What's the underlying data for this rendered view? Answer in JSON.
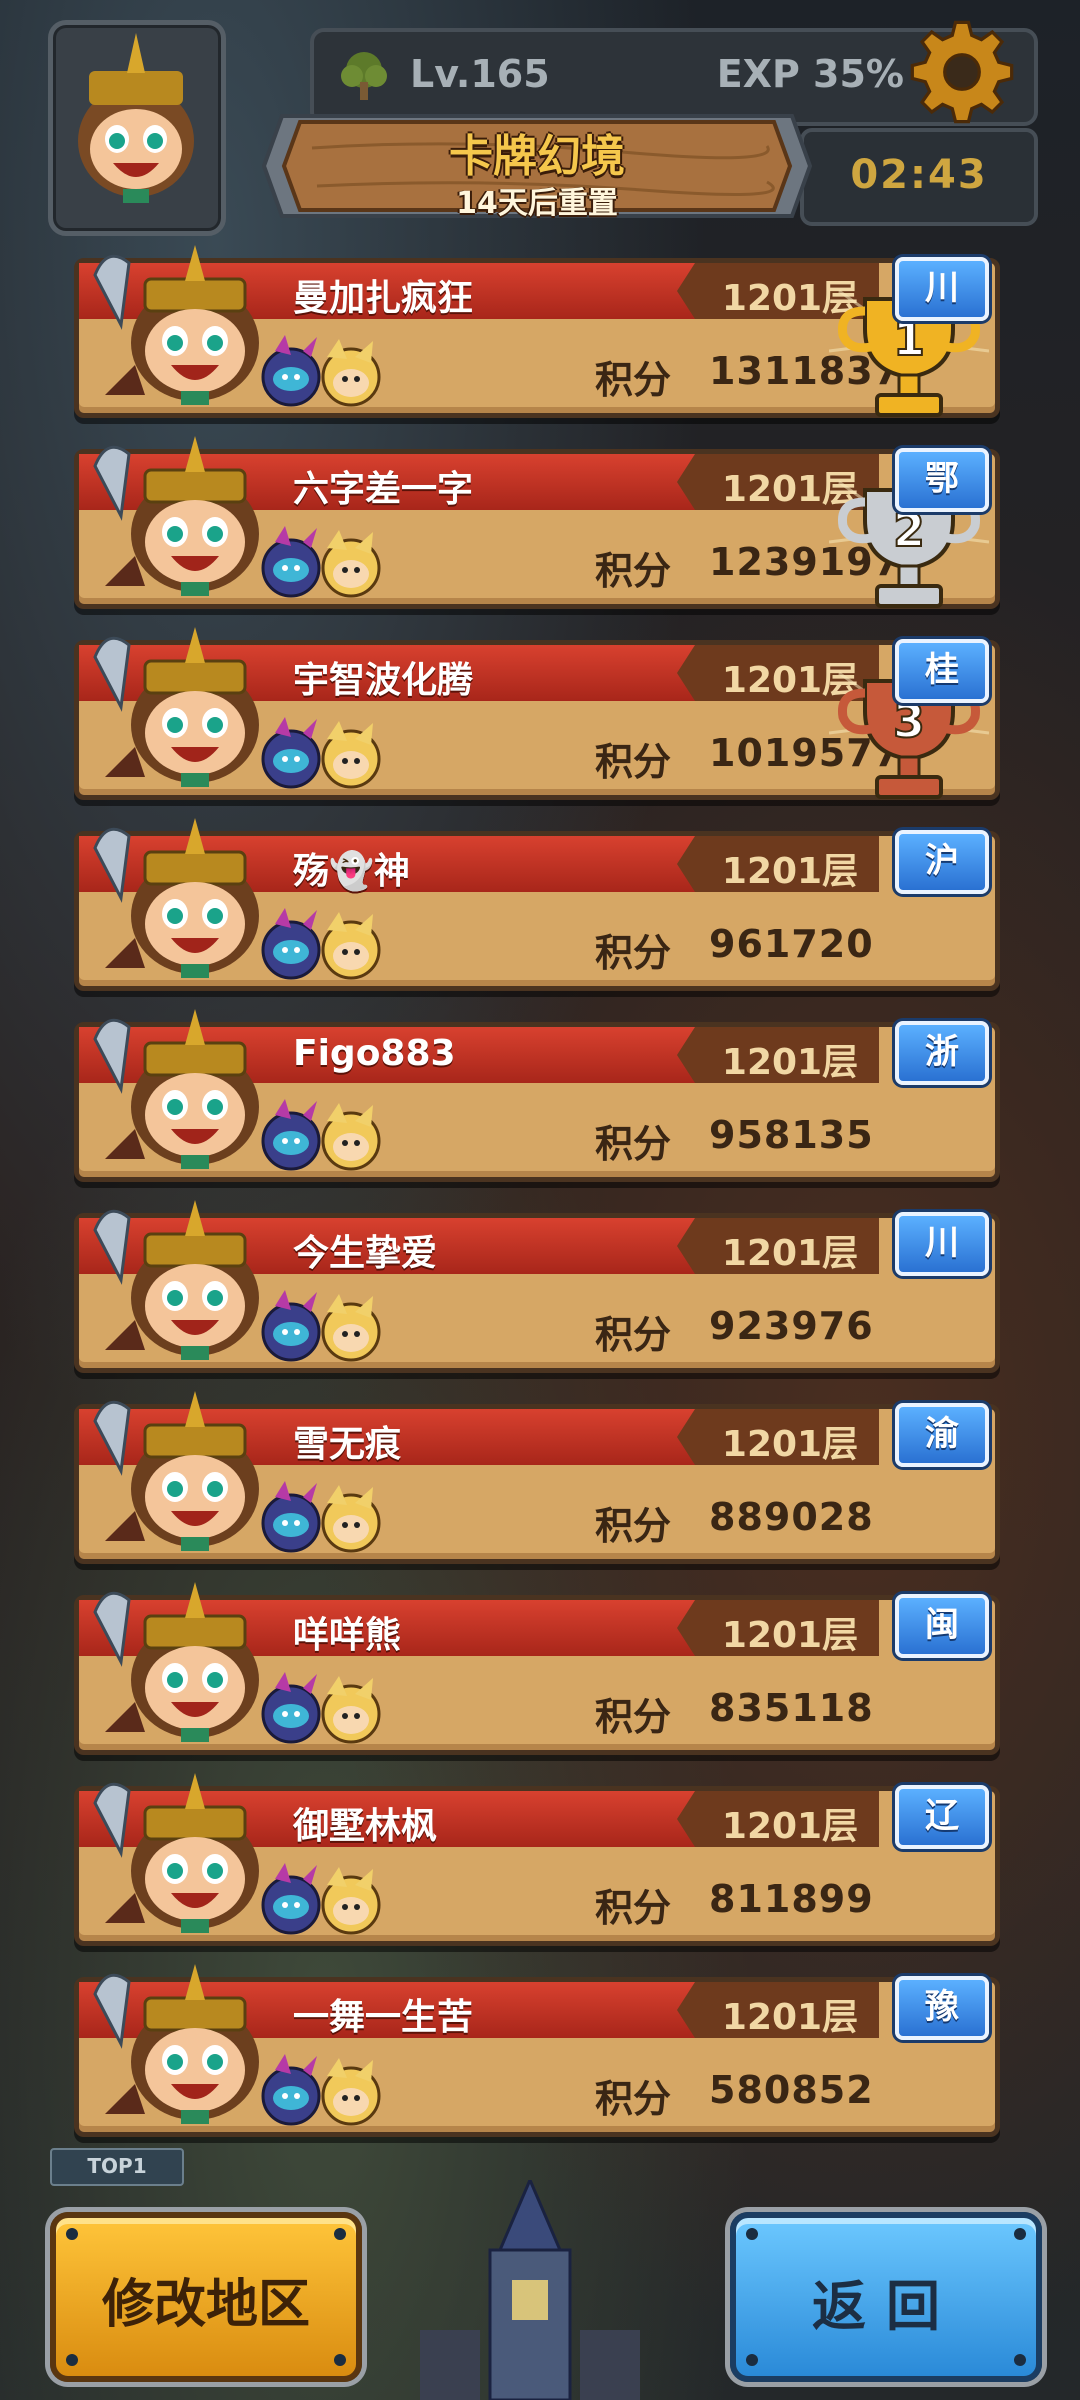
{
  "header": {
    "level": "Lv.165",
    "exp": "EXP 35%",
    "title": "卡牌幻境",
    "subtitle": "14天后重置",
    "timer": "02:43"
  },
  "ranking": [
    {
      "name": "曼加扎疯狂",
      "floor": "1201层",
      "score_label": "积分",
      "score": "1311837",
      "region": "川",
      "trophy": "gold"
    },
    {
      "name": "六字差一字",
      "floor": "1201层",
      "score_label": "积分",
      "score": "1239197",
      "region": "鄂",
      "trophy": "silver"
    },
    {
      "name": "宇智波化腾",
      "floor": "1201层",
      "score_label": "积分",
      "score": "1019577",
      "region": "桂",
      "trophy": "bronze"
    },
    {
      "name": "殇👻神",
      "floor": "1201层",
      "score_label": "积分",
      "score": "961720",
      "region": "沪",
      "trophy": ""
    },
    {
      "name": "Figo883",
      "floor": "1201层",
      "score_label": "积分",
      "score": "958135",
      "region": "浙",
      "trophy": ""
    },
    {
      "name": "今生挚爱",
      "floor": "1201层",
      "score_label": "积分",
      "score": "923976",
      "region": "川",
      "trophy": ""
    },
    {
      "name": "雪无痕",
      "floor": "1201层",
      "score_label": "积分",
      "score": "889028",
      "region": "渝",
      "trophy": ""
    },
    {
      "name": "咩咩熊",
      "floor": "1201层",
      "score_label": "积分",
      "score": "835118",
      "region": "闽",
      "trophy": ""
    },
    {
      "name": "御墅林枫",
      "floor": "1201层",
      "score_label": "积分",
      "score": "811899",
      "region": "辽",
      "trophy": ""
    },
    {
      "name": "一舞一生苦",
      "floor": "1201层",
      "score_label": "积分",
      "score": "580852",
      "region": "豫",
      "trophy": ""
    }
  ],
  "background": {
    "badge": "TOP1"
  },
  "buttons": {
    "change_region": "修改地区",
    "back": "返回"
  },
  "colors": {
    "gold": "#f0b323",
    "silver": "#c9cdd2",
    "bronze": "#c6593a",
    "banner_red": "#c9311f",
    "region_blue": "#3a8ae6"
  },
  "icons": {
    "settings": "gear-icon",
    "level": "tree-icon"
  }
}
